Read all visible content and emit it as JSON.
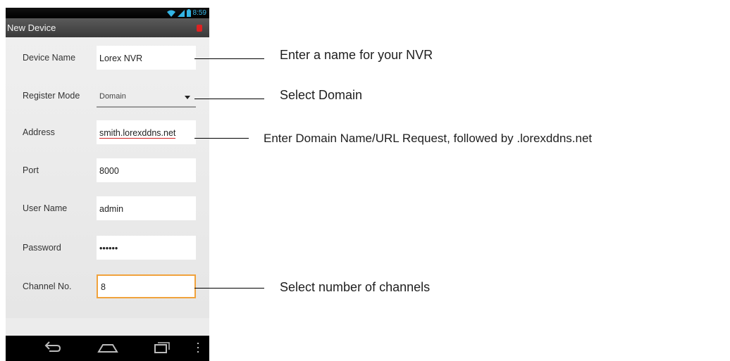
{
  "status_bar": {
    "time": "8:59"
  },
  "action_bar": {
    "title": "New Device"
  },
  "form": {
    "fields": [
      {
        "label": "Device Name",
        "value": "Lorex NVR"
      },
      {
        "label": "Register Mode",
        "value": "Domain"
      },
      {
        "label": "Address",
        "value": "smith.lorexddns.net"
      },
      {
        "label": "Port",
        "value": "8000"
      },
      {
        "label": "User Name",
        "value": "admin"
      },
      {
        "label": "Password",
        "value": "••••••"
      },
      {
        "label": "Channel No.",
        "value": "8"
      }
    ]
  },
  "callouts": {
    "device_name": "Enter a name for your NVR",
    "register_mode": "Select Domain",
    "address": "Enter Domain Name/URL Request, followed by .lorexddns.net",
    "channel": "Select number of channels"
  },
  "colors": {
    "accent_blue": "#33b5e5",
    "focus_orange": "#f0a23c",
    "spellcheck_red": "#d02020"
  },
  "icons": [
    "wifi-icon",
    "signal-icon",
    "battery-icon",
    "back-icon",
    "home-icon",
    "recent-apps-icon",
    "menu-icon"
  ]
}
